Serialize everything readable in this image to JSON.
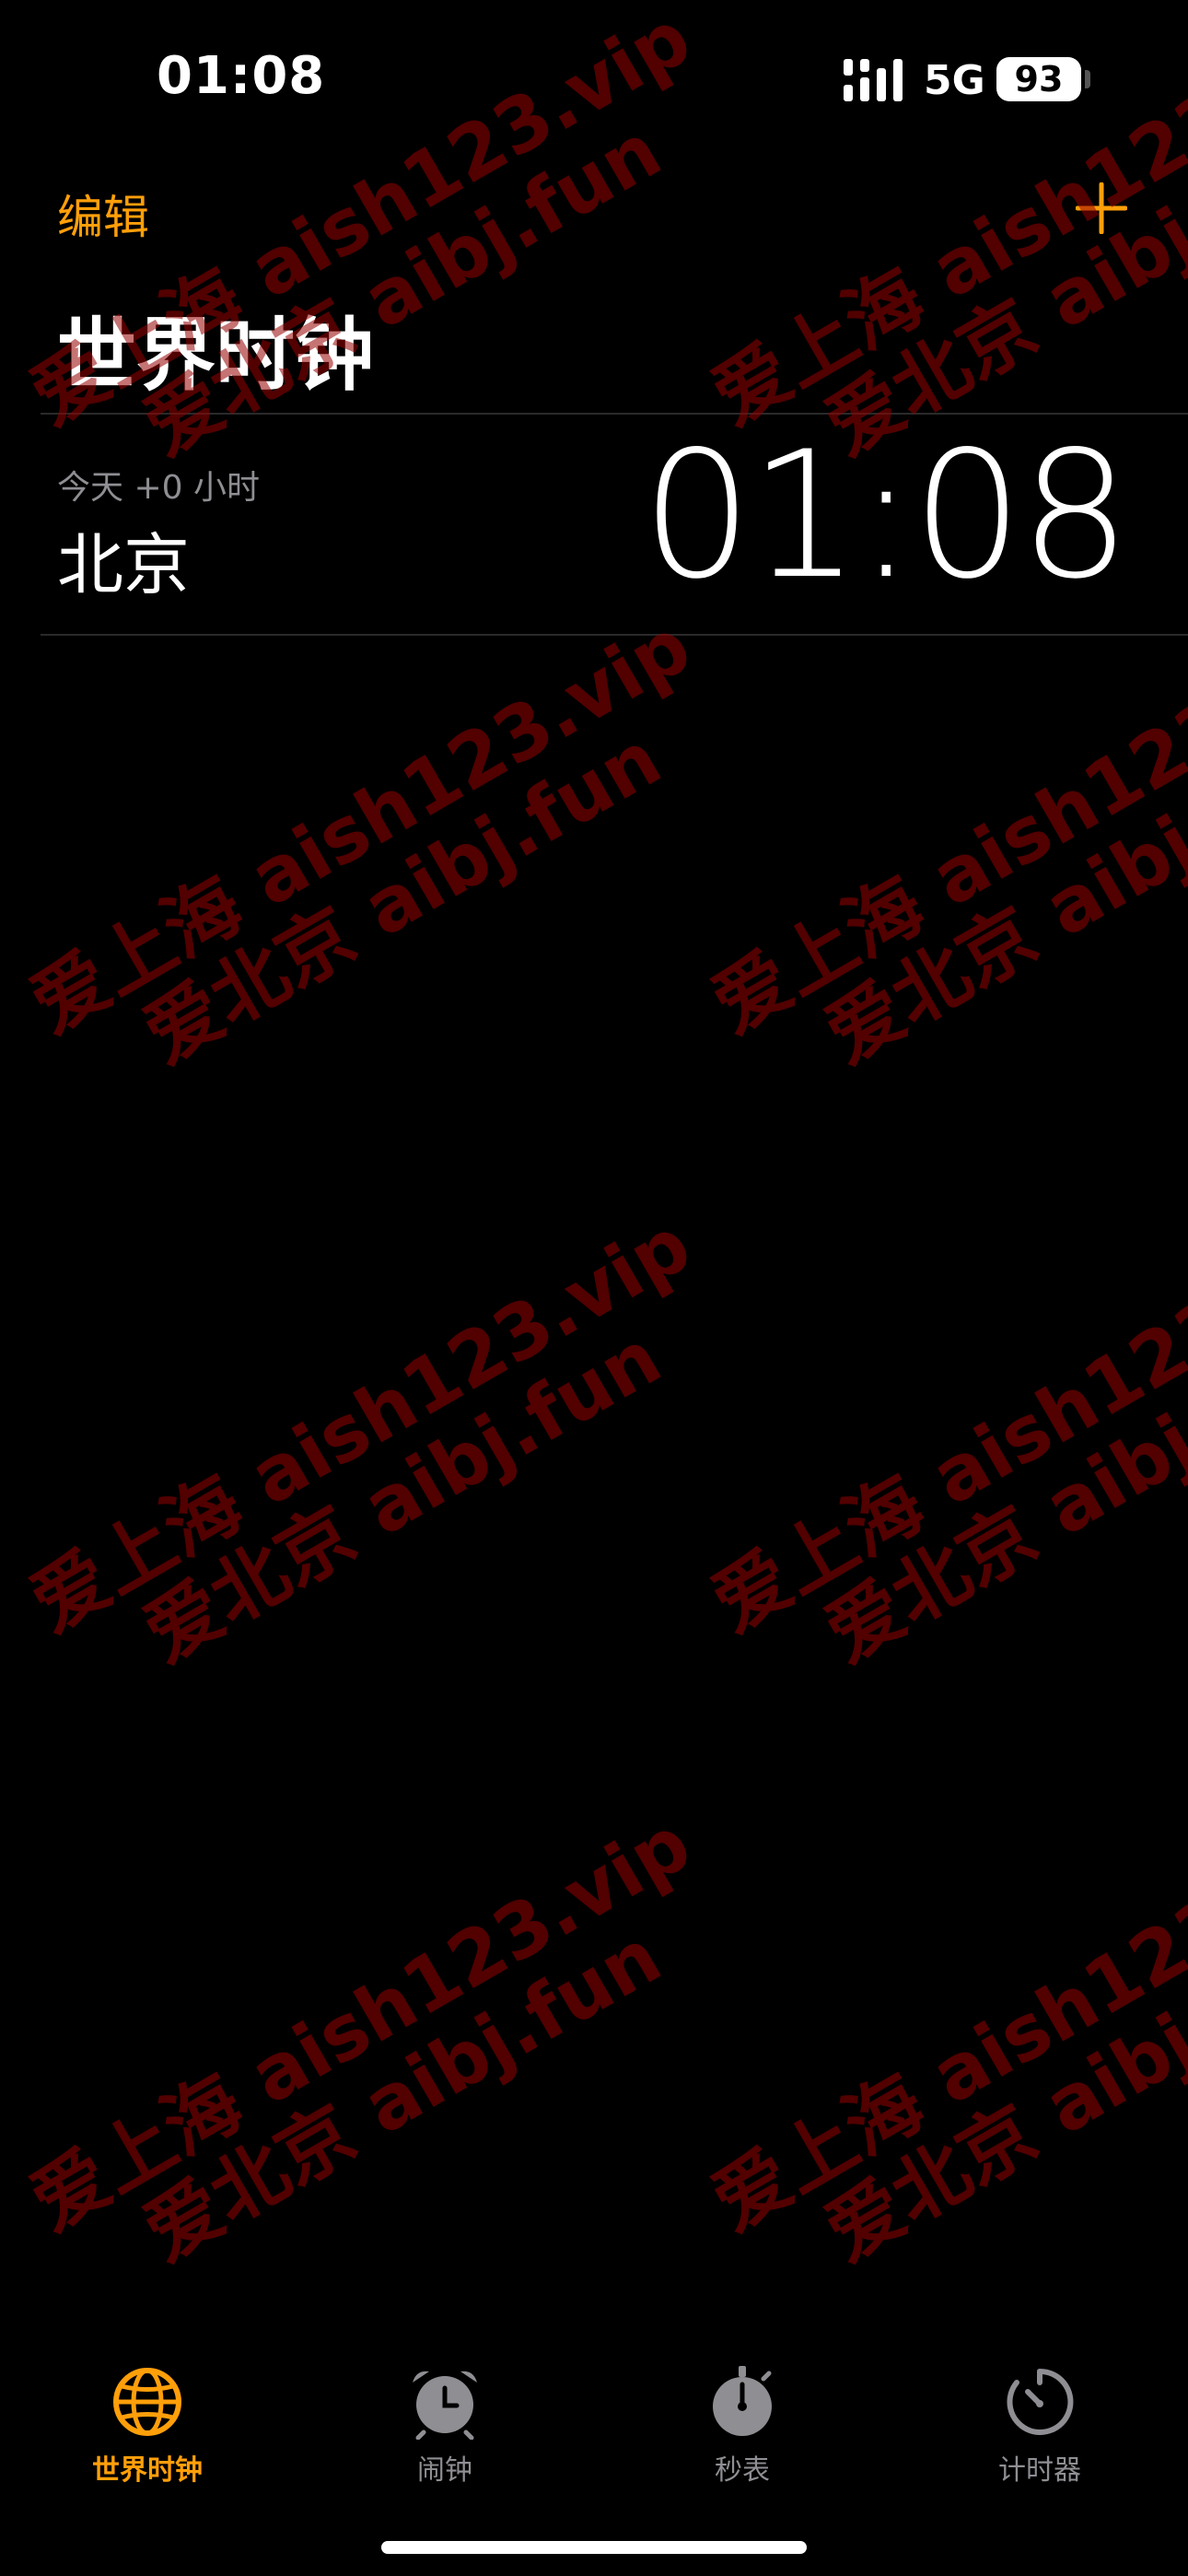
{
  "status_bar": {
    "time": "01:08",
    "network": "5G",
    "battery": "93"
  },
  "nav": {
    "edit_label": "编辑",
    "add_label": "+"
  },
  "page": {
    "title": "世界时钟"
  },
  "clocks": [
    {
      "offset": "今天 +0 小时",
      "city": "北京",
      "time": "01:08"
    }
  ],
  "tabs": [
    {
      "label": "世界时钟",
      "icon": "globe-icon",
      "active": true
    },
    {
      "label": "闹钟",
      "icon": "alarm-clock-icon",
      "active": false
    },
    {
      "label": "秒表",
      "icon": "stopwatch-icon",
      "active": false
    },
    {
      "label": "计时器",
      "icon": "timer-icon",
      "active": false
    }
  ],
  "watermark": {
    "line1": "爱上海 aish123.vip",
    "line2": "爱北京 aibj.fun"
  },
  "colors": {
    "accent": "#ff9f0a",
    "background": "#000000",
    "secondary_text": "#8e8e93"
  }
}
